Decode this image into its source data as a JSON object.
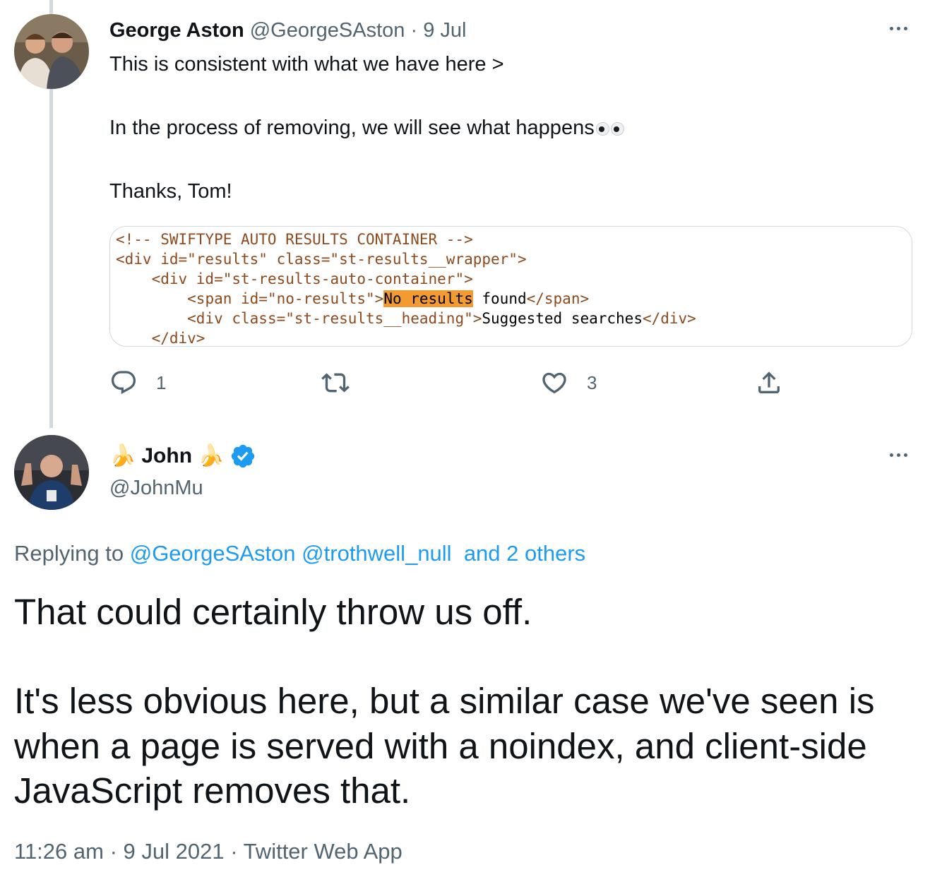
{
  "tweet1": {
    "name": "George Aston",
    "handle": "@GeorgeSAston",
    "separator": " · ",
    "date": "9 Jul",
    "line1": "This is consistent with what we have here >",
    "line2": "In the process of removing, we will see what happens",
    "line3": "Thanks, Tom!",
    "code": {
      "line1": "<!-- SWIFTYPE AUTO RESULTS CONTAINER -->",
      "line2": "<div id=\"results\" class=\"st-results__wrapper\">",
      "line3": "<div id=\"st-results-auto-container\">",
      "line4_open": "<span id=\"no-results\">",
      "line4_highlight": "No results",
      "line4_text": " found",
      "line4_close": "</span>",
      "line5_open": "<div class=\"st-results__heading\">",
      "line5_text": "Suggested searches",
      "line5_close": "</div>",
      "line6": "</div>"
    },
    "reply_count": "1",
    "like_count": "3"
  },
  "tweet2": {
    "emoji": "🍌",
    "name": "John",
    "handle": "@JohnMu",
    "replying_prefix": "Replying to ",
    "reply_to_1": "@GeorgeSAston",
    "reply_to_2": "@trothwell_null",
    "reply_to_others": "and 2 others",
    "text_line1": "That could certainly throw us off.",
    "text_line2": "It's less obvious here, but a similar case we've seen is",
    "text_line3": "when a page is served with a noindex, and client-side",
    "text_line4": "JavaScript removes that.",
    "time": "11:26 am",
    "separator": " · ",
    "date": "9 Jul 2021",
    "source": "Twitter Web App"
  },
  "colors": {
    "accent": "#1d9bf0",
    "secondary_text": "#536471",
    "primary_text": "#0f1419",
    "highlight": "#f39b31",
    "thread_line": "#cfd9de"
  },
  "icons": {
    "reply": "reply-icon",
    "retweet": "retweet-icon",
    "like": "heart-icon",
    "share": "share-icon",
    "more": "more-icon",
    "verified": "verified-badge-icon"
  }
}
